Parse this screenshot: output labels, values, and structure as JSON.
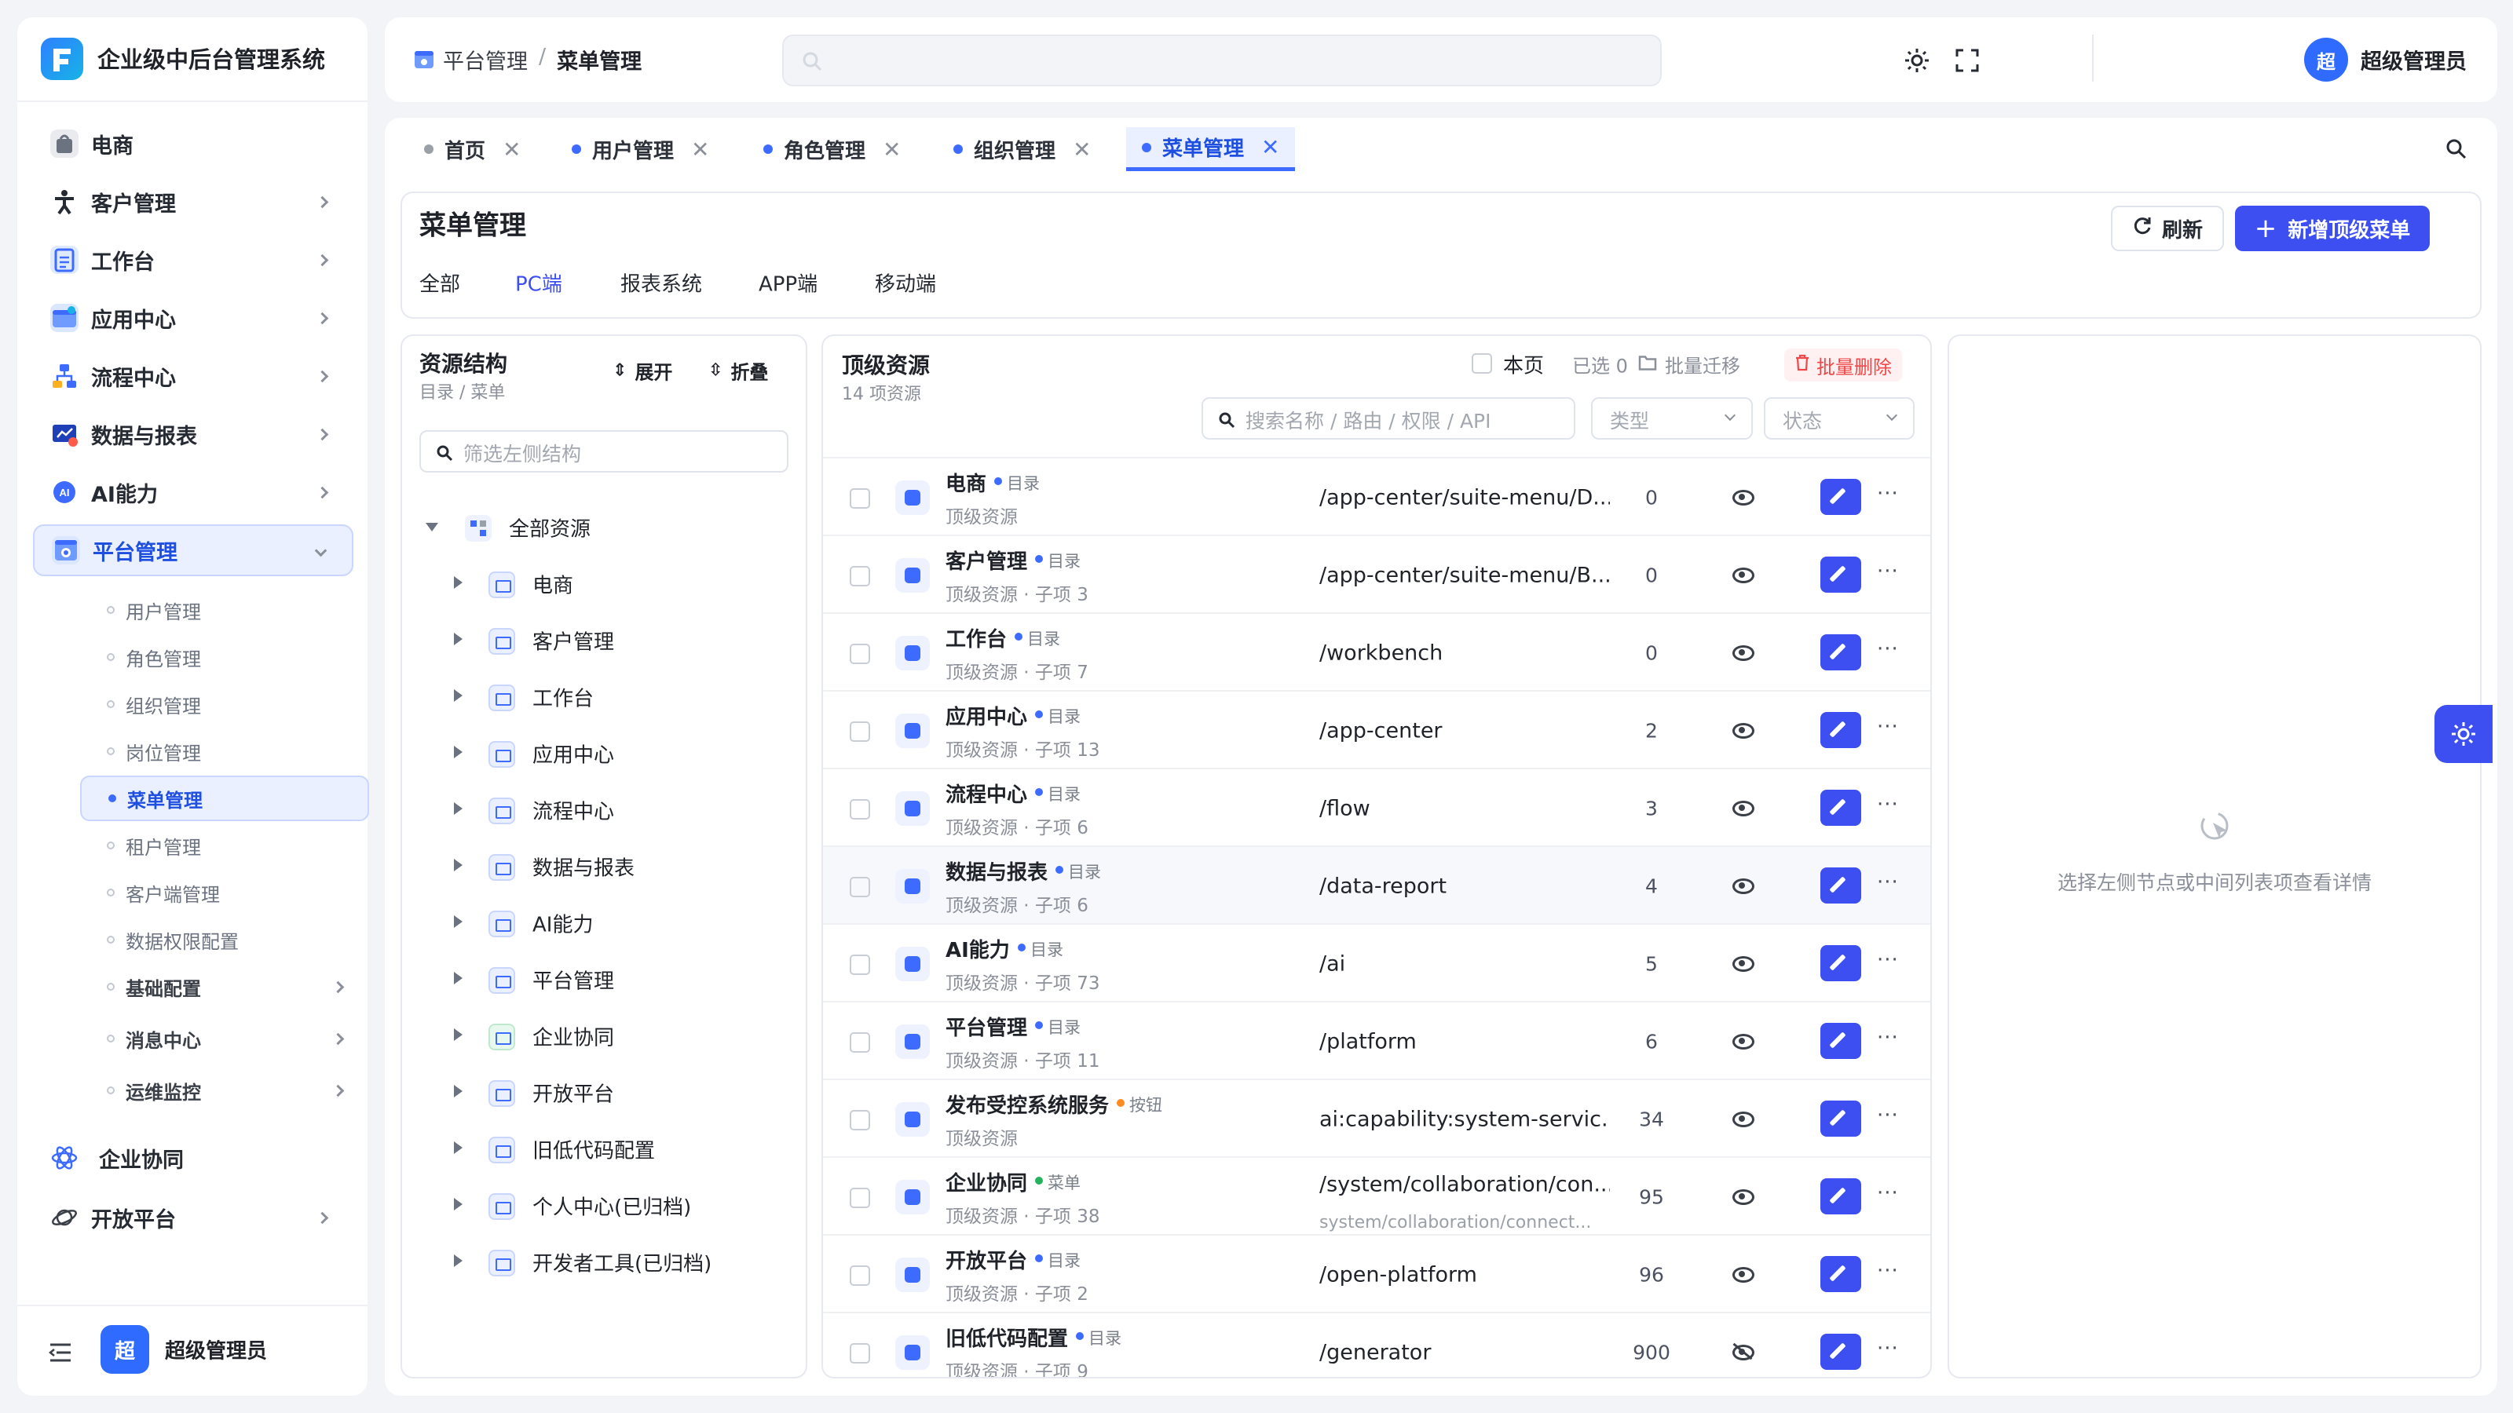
{
  "app": {
    "title": "企业级中后台管理系统",
    "user_name": "超级管理员",
    "avatar_text": "超"
  },
  "sidebar": {
    "items": [
      {
        "label": "电商",
        "icon": "shopping-bag-icon"
      },
      {
        "label": "客户管理",
        "icon": "person-icon"
      },
      {
        "label": "工作台",
        "icon": "clipboard-icon"
      },
      {
        "label": "应用中心",
        "icon": "app-window-icon"
      },
      {
        "label": "流程中心",
        "icon": "flow-icon"
      },
      {
        "label": "数据与报表",
        "icon": "chart-screen-icon"
      },
      {
        "label": "AI能力",
        "icon": "ai-icon"
      },
      {
        "label": "平台管理",
        "icon": "platform-gear-icon"
      }
    ],
    "sub_items": [
      "用户管理",
      "角色管理",
      "组织管理",
      "岗位管理",
      "菜单管理",
      "租户管理",
      "客户端管理",
      "数据权限配置",
      "基础配置",
      "消息中心",
      "运维监控"
    ],
    "items_bottom": [
      {
        "label": "企业协同",
        "icon": "atom-icon"
      },
      {
        "label": "开放平台",
        "icon": "planet-icon"
      }
    ]
  },
  "header": {
    "breadcrumb_parent": "平台管理",
    "breadcrumb_sep": "/",
    "breadcrumb_current": "菜单管理",
    "search_placeholder": ""
  },
  "tabs": [
    {
      "label": "首页"
    },
    {
      "label": "用户管理"
    },
    {
      "label": "角色管理"
    },
    {
      "label": "组织管理"
    },
    {
      "label": "菜单管理"
    }
  ],
  "page": {
    "title": "菜单管理",
    "refresh_label": "刷新",
    "add_label": "新增顶级菜单",
    "subtabs": [
      "全部",
      "PC端",
      "报表系统",
      "APP端",
      "移动端"
    ],
    "active_subtab": "PC端"
  },
  "tree": {
    "title": "资源结构",
    "subtitle": "目录 / 菜单",
    "expand_label": "展开",
    "collapse_label": "折叠",
    "filter_placeholder": "筛选左侧结构",
    "root": "全部资源",
    "nodes": [
      "电商",
      "客户管理",
      "工作台",
      "应用中心",
      "流程中心",
      "数据与报表",
      "AI能力",
      "平台管理",
      "企业协同",
      "开放平台",
      "旧低代码配置",
      "个人中心(已归档)",
      "开发者工具(已归档)"
    ]
  },
  "list": {
    "title": "顶级资源",
    "count_text": "14 项资源",
    "this_page_label": "本页",
    "selected_text": "已选 0",
    "migrate_label": "批量迁移",
    "delete_label": "批量删除",
    "search_placeholder": "搜索名称 / 路由 / 权限 / API",
    "type_placeholder": "类型",
    "status_placeholder": "状态",
    "rows": [
      {
        "name": "电商",
        "kind": "目录",
        "meta": "顶级资源",
        "path": "/app-center/suite-menu/D...",
        "path2": "",
        "num": "0",
        "visible": true
      },
      {
        "name": "客户管理",
        "kind": "目录",
        "meta": "顶级资源 · 子项 3",
        "path": "/app-center/suite-menu/B...",
        "path2": "",
        "num": "0",
        "visible": true
      },
      {
        "name": "工作台",
        "kind": "目录",
        "meta": "顶级资源 · 子项 7",
        "path": "/workbench",
        "path2": "",
        "num": "0",
        "visible": true
      },
      {
        "name": "应用中心",
        "kind": "目录",
        "meta": "顶级资源 · 子项 13",
        "path": "/app-center",
        "path2": "",
        "num": "2",
        "visible": true
      },
      {
        "name": "流程中心",
        "kind": "目录",
        "meta": "顶级资源 · 子项 6",
        "path": "/flow",
        "path2": "",
        "num": "3",
        "visible": true
      },
      {
        "name": "数据与报表",
        "kind": "目录",
        "meta": "顶级资源 · 子项 6",
        "path": "/data-report",
        "path2": "",
        "num": "4",
        "visible": true
      },
      {
        "name": "AI能力",
        "kind": "目录",
        "meta": "顶级资源 · 子项 73",
        "path": "/ai",
        "path2": "",
        "num": "5",
        "visible": true
      },
      {
        "name": "平台管理",
        "kind": "目录",
        "meta": "顶级资源 · 子项 11",
        "path": "/platform",
        "path2": "",
        "num": "6",
        "visible": true
      },
      {
        "name": "发布受控系统服务",
        "kind": "按钮",
        "meta": "顶级资源",
        "path": "ai:capability:system-servic...",
        "path2": "",
        "num": "34",
        "visible": true
      },
      {
        "name": "企业协同",
        "kind": "菜单",
        "meta": "顶级资源 · 子项 38",
        "path": "/system/collaboration/con...",
        "path2": "system/collaboration/connect...",
        "num": "95",
        "visible": true
      },
      {
        "name": "开放平台",
        "kind": "目录",
        "meta": "顶级资源 · 子项 2",
        "path": "/open-platform",
        "path2": "",
        "num": "96",
        "visible": true
      },
      {
        "name": "旧低代码配置",
        "kind": "目录",
        "meta": "顶级资源 · 子项 9",
        "path": "/generator",
        "path2": "",
        "num": "900",
        "visible": false
      }
    ]
  },
  "detail": {
    "empty_text": "选择左侧节点或中间列表项查看详情"
  },
  "colors": {
    "primary": "#3d4ff0",
    "accent_blue": "#3d6bff",
    "danger": "#f04848",
    "kind_dir": "#3d6bff",
    "kind_button": "#ff8a1f",
    "kind_menu": "#22b35e"
  }
}
